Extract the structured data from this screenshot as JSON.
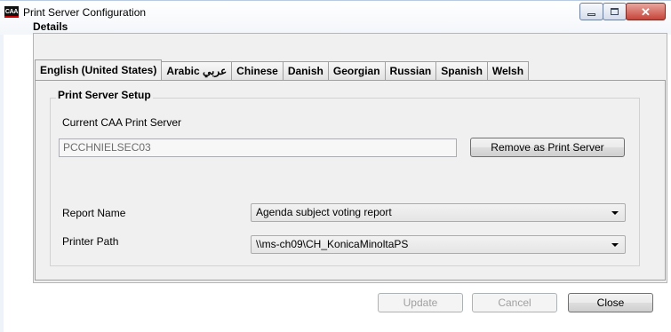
{
  "window": {
    "title": "Print Server Configuration",
    "icon": "CAA",
    "icon_name": "caa-app-icon"
  },
  "details": {
    "label": "Details"
  },
  "tabs": [
    {
      "label": "English (United States)",
      "active": true
    },
    {
      "label": "Arabic عربي",
      "active": false
    },
    {
      "label": "Chinese",
      "active": false
    },
    {
      "label": "Danish",
      "active": false
    },
    {
      "label": "Georgian",
      "active": false
    },
    {
      "label": "Russian",
      "active": false
    },
    {
      "label": "Spanish",
      "active": false
    },
    {
      "label": "Welsh",
      "active": false
    }
  ],
  "setup": {
    "title": "Print Server Setup",
    "current_server_label": "Current CAA Print Server",
    "current_server_value": "PCCHNIELSEC03",
    "remove_button": "Remove as Print Server",
    "report_name_label": "Report Name",
    "report_name_value": "Agenda subject voting report",
    "printer_path_label": "Printer Path",
    "printer_path_value": "\\\\ms-ch09\\CH_KonicaMinoltaPS"
  },
  "footer": {
    "update": "Update",
    "cancel": "Cancel",
    "close": "Close"
  }
}
